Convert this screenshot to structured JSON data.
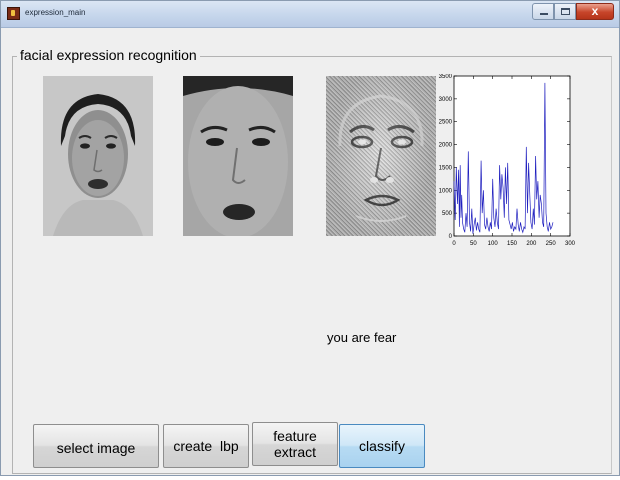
{
  "window": {
    "title": "expression_main",
    "menu": [
      "",
      "",
      "",
      ""
    ],
    "controls": {
      "close_glyph": "x"
    }
  },
  "panel": {
    "title": "facial expression recognition"
  },
  "result": {
    "text": "you are fear"
  },
  "buttons": {
    "select_image": "select image",
    "create_lbp": "create  lbp",
    "feature_extract": "feature extract",
    "classify": "classify"
  },
  "chart_data": {
    "type": "line",
    "title": "",
    "xlabel": "",
    "ylabel": "",
    "xlim": [
      0,
      300
    ],
    "ylim": [
      0,
      3500
    ],
    "xticks": [
      0,
      50,
      100,
      150,
      200,
      250,
      300
    ],
    "yticks": [
      0,
      500,
      1000,
      1500,
      2000,
      2500,
      3000,
      3500
    ],
    "series": [
      {
        "color": "#1f1fbf",
        "x": [
          0,
          3,
          6,
          9,
          12,
          14,
          16,
          18,
          20,
          22,
          25,
          28,
          31,
          34,
          37,
          40,
          43,
          46,
          49,
          52,
          55,
          58,
          61,
          64,
          67,
          70,
          73,
          76,
          79,
          82,
          85,
          88,
          91,
          94,
          97,
          100,
          103,
          106,
          109,
          112,
          115,
          118,
          121,
          124,
          127,
          130,
          133,
          136,
          139,
          142,
          145,
          148,
          151,
          154,
          157,
          160,
          163,
          166,
          169,
          172,
          175,
          178,
          181,
          184,
          187,
          190,
          193,
          196,
          199,
          202,
          205,
          208,
          211,
          214,
          217,
          220,
          223,
          226,
          229,
          232,
          235,
          238,
          241,
          244,
          247,
          250,
          253,
          256
        ],
        "y": [
          1200,
          350,
          1500,
          700,
          1450,
          200,
          1550,
          400,
          900,
          300,
          150,
          80,
          500,
          200,
          1850,
          300,
          100,
          600,
          50,
          250,
          400,
          120,
          300,
          150,
          80,
          1650,
          500,
          1000,
          250,
          150,
          400,
          200,
          100,
          300,
          150,
          1250,
          400,
          200,
          600,
          300,
          150,
          1550,
          800,
          1350,
          1050,
          400,
          1500,
          700,
          1600,
          350,
          250,
          150,
          300,
          100,
          200,
          150,
          600,
          250,
          100,
          300,
          150,
          80,
          200,
          150,
          1950,
          500,
          1600,
          900,
          300,
          150,
          600,
          250,
          1750,
          800,
          1200,
          400,
          900,
          700,
          300,
          200,
          3350,
          500,
          200,
          100,
          300,
          150,
          200,
          300
        ]
      }
    ]
  }
}
